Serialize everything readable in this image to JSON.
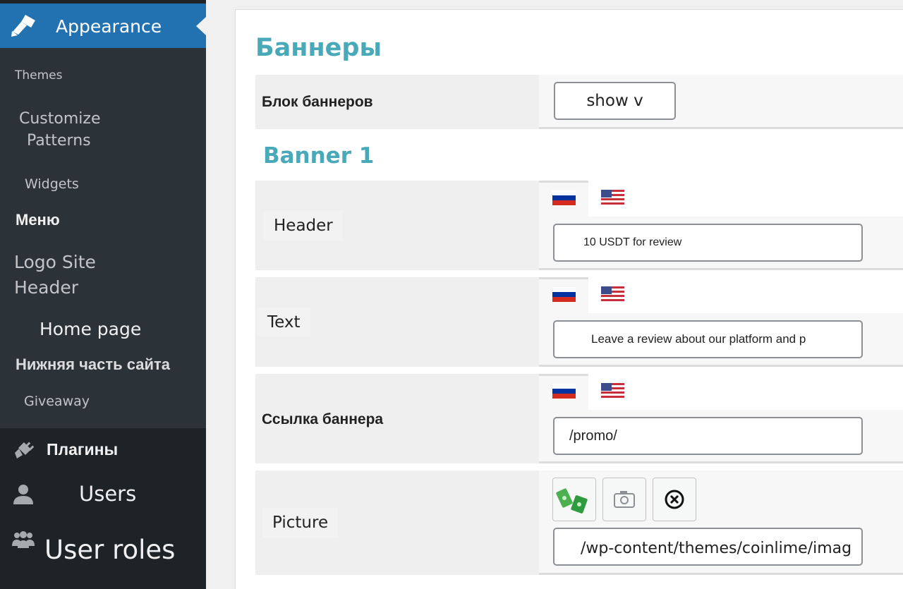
{
  "sidebar": {
    "current": {
      "label": "Appearance",
      "icon": "paintbrush-icon"
    },
    "submenu": [
      {
        "label": "Themes"
      },
      {
        "label": "Customize"
      },
      {
        "label": "Patterns"
      },
      {
        "label": "Widgets"
      },
      {
        "label": "Меню"
      },
      {
        "label": "Logo Site"
      },
      {
        "label": "Header"
      },
      {
        "label": "Home page"
      },
      {
        "label": "Нижняя часть сайта"
      },
      {
        "label": "Giveaway"
      }
    ],
    "menu": [
      {
        "label": "Плагины",
        "icon": "plugin-icon"
      },
      {
        "label": "Users",
        "icon": "user-icon"
      },
      {
        "label": "User roles",
        "icon": "groups-icon"
      }
    ]
  },
  "main": {
    "section_title": "Баннеры",
    "banner_block": {
      "label": "Блок баннеров",
      "value": "show v"
    },
    "banner1": {
      "title": "Banner 1",
      "header": {
        "label": "Header",
        "value": "10 USDT for review"
      },
      "text": {
        "label": "Text",
        "value": "Leave a review about our platform and p"
      },
      "link": {
        "label": "Ссылка баннера",
        "value": "/promo/"
      },
      "picture": {
        "label": "Picture",
        "value": "/wp-content/themes/coinlime/imag"
      }
    },
    "languages": [
      "ru",
      "en"
    ]
  },
  "colors": {
    "accent": "#2271b1",
    "sidebar": "#2c3338",
    "sidebar_dark": "#1d2327",
    "title": "#4aa9b8"
  }
}
